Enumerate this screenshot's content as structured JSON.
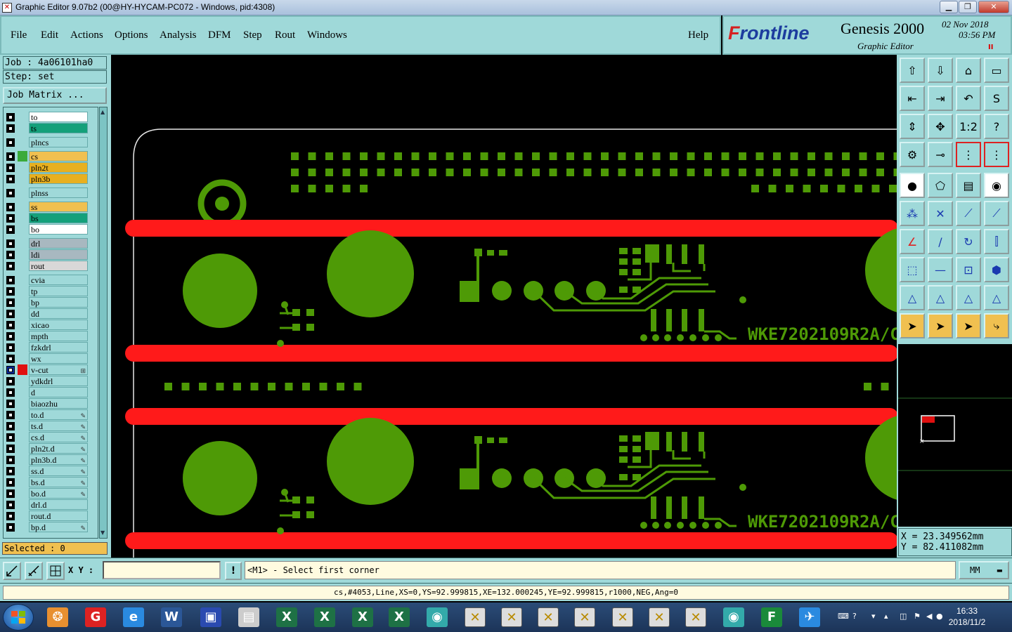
{
  "window": {
    "title": "Graphic Editor 9.07b2 (00@HY-HYCAM-PC072 - Windows, pid:4308)"
  },
  "menu": {
    "items": [
      "File",
      "Edit",
      "Actions",
      "Options",
      "Analysis",
      "DFM",
      "Step",
      "Rout",
      "Windows"
    ],
    "help": "Help"
  },
  "brand": {
    "logo_f": "F",
    "logo_rest": "rontline",
    "product": "Genesis 2000",
    "subtitle": "Graphic Editor",
    "date": "02 Nov 2018",
    "time": "03:56 PM",
    "pause": "II"
  },
  "panel": {
    "job": "Job : 4a06101ha0",
    "step": "Step: set",
    "job_matrix": "Job Matrix ...",
    "selected": "Selected : 0"
  },
  "layers": [
    {
      "name": "to",
      "color": "#ffffff"
    },
    {
      "name": "ts",
      "color": "#14a07a"
    },
    {
      "name": "plncs",
      "color": "#9fd9d9"
    },
    {
      "name": "cs",
      "color": "#f0c050",
      "active": "#3aaa3a"
    },
    {
      "name": "pln2t",
      "color": "#e8b020"
    },
    {
      "name": "pln3b",
      "color": "#e8b020"
    },
    {
      "name": "plnss",
      "color": "#9fd9d9"
    },
    {
      "name": "ss",
      "color": "#f0c050"
    },
    {
      "name": "bs",
      "color": "#14a07a"
    },
    {
      "name": "bo",
      "color": "#ffffff"
    },
    {
      "name": "drl",
      "color": "#a8b8c0"
    },
    {
      "name": "ldi",
      "color": "#a8b8c0"
    },
    {
      "name": "rout",
      "color": "#d8d8d8"
    },
    {
      "name": "cvia",
      "color": "#9fd9d9"
    },
    {
      "name": "tp",
      "color": "#9fd9d9"
    },
    {
      "name": "bp",
      "color": "#9fd9d9"
    },
    {
      "name": "dd",
      "color": "#9fd9d9"
    },
    {
      "name": "xicao",
      "color": "#9fd9d9"
    },
    {
      "name": "mpth",
      "color": "#9fd9d9"
    },
    {
      "name": "fzkdrl",
      "color": "#9fd9d9"
    },
    {
      "name": "wx",
      "color": "#9fd9d9"
    },
    {
      "name": "v-cut",
      "color": "#9fd9d9",
      "active": "#e01010",
      "on": true,
      "mark": "⊞"
    },
    {
      "name": "ydkdrl",
      "color": "#9fd9d9"
    },
    {
      "name": "d",
      "color": "#9fd9d9"
    },
    {
      "name": "biaozhu",
      "color": "#9fd9d9"
    },
    {
      "name": "to.d",
      "color": "#9fd9d9",
      "mark": "✎"
    },
    {
      "name": "ts.d",
      "color": "#9fd9d9",
      "mark": "✎"
    },
    {
      "name": "cs.d",
      "color": "#9fd9d9",
      "mark": "✎"
    },
    {
      "name": "pln2t.d",
      "color": "#9fd9d9",
      "mark": "✎"
    },
    {
      "name": "pln3b.d",
      "color": "#9fd9d9",
      "mark": "✎"
    },
    {
      "name": "ss.d",
      "color": "#9fd9d9",
      "mark": "✎"
    },
    {
      "name": "bs.d",
      "color": "#9fd9d9",
      "mark": "✎"
    },
    {
      "name": "bo.d",
      "color": "#9fd9d9",
      "mark": "✎"
    },
    {
      "name": "drl.d",
      "color": "#9fd9d9"
    },
    {
      "name": "rout.d",
      "color": "#9fd9d9"
    },
    {
      "name": "bp.d",
      "color": "#9fd9d9",
      "mark": "✎"
    }
  ],
  "canvas": {
    "label": "WKE7202109R2A/C",
    "trace_color": "#ff1a1a",
    "copper_color": "#4e9a06"
  },
  "coords": {
    "x": "X = 23.349562mm",
    "y": "Y = 82.411082mm"
  },
  "bottom": {
    "xy_label": "X Y :",
    "xy_value": "",
    "warn": "!",
    "prompt": "<M1> - Select first corner",
    "units": "MM"
  },
  "status": "cs,#4053,Line,XS=0,YS=92.999815,XE=132.000245,YE=92.999815,r1000,NEG,Ang=0",
  "toolbar_icons": [
    "zoom-home-icon",
    "zoom-page-icon",
    "zoom-step-icon",
    "zoom-profile-icon",
    "pan-left-icon",
    "pan-right-icon",
    "undo-zoom-icon",
    "redraw-icon",
    "fit-vertical-icon",
    "fit-all-icon",
    "ratio-icon",
    "help-icon",
    "snap-settings-icon",
    "measure-icon",
    "layers-red-icon",
    "layers-red2-icon",
    "fill-icon",
    "polygon-icon",
    "ruler-icon",
    "pad-icon",
    "connect-icon",
    "delete-icon",
    "line-icon",
    "line2-icon",
    "angle-icon",
    "slash-icon",
    "arc-icon",
    "compare-icon",
    "move-icon",
    "dash-icon",
    "bracket-icon",
    "shape-icon",
    "tri-icon",
    "tri2-icon",
    "tri3-icon",
    "tri4-icon",
    "pointer-icon",
    "select-icon",
    "select2-icon",
    "route-icon"
  ],
  "taskbar": {
    "time": "16:33",
    "date": "2018/11/2"
  }
}
